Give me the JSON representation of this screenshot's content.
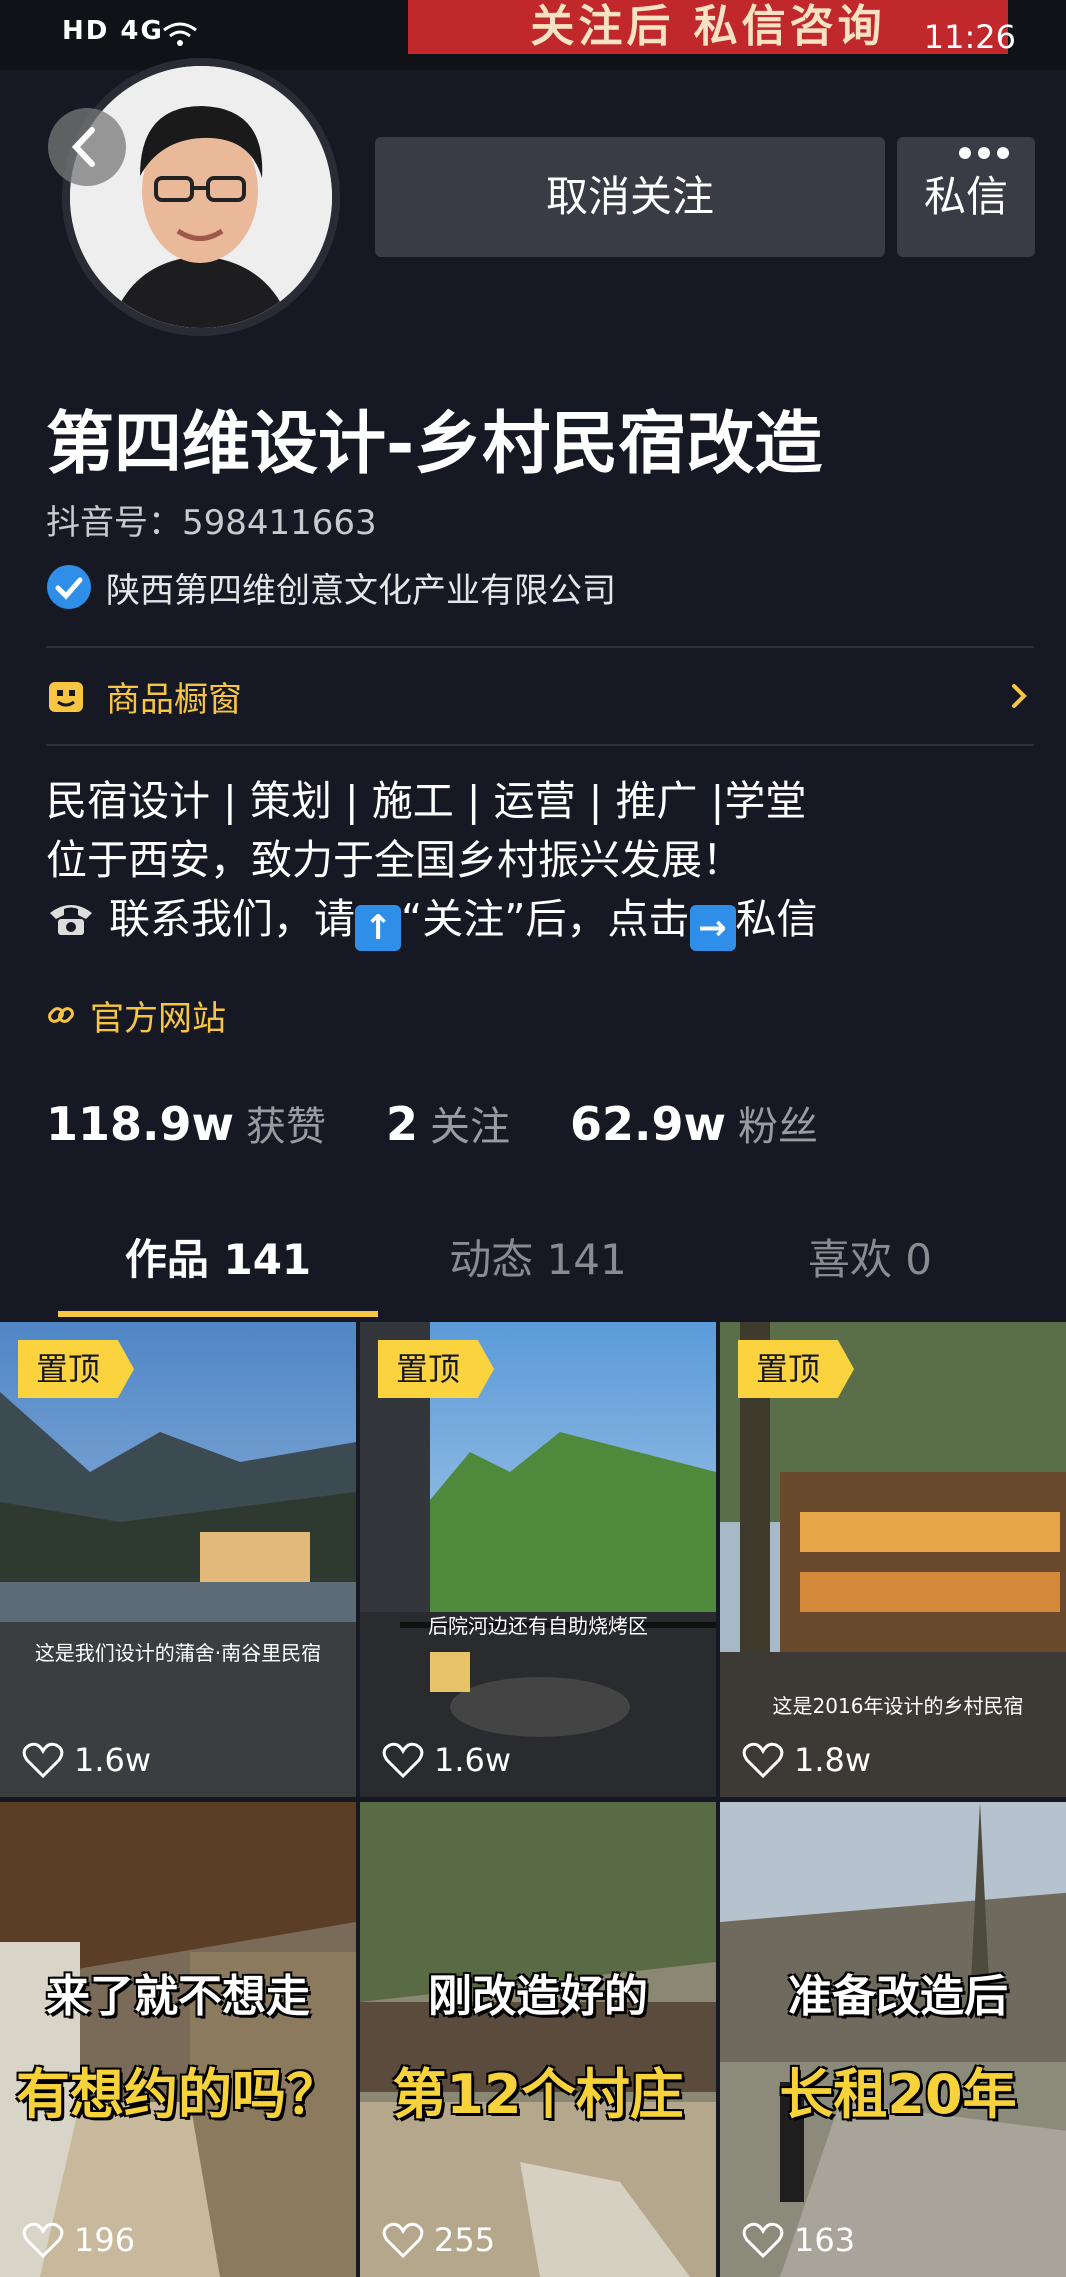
{
  "status_bar": {
    "left": "HD 4G",
    "time": "11:26"
  },
  "banner_text": "关注后 私信咨询",
  "header": {
    "unfollow_label": "取消关注",
    "message_label": "私信",
    "title": "第四维设计-乡村民宿改造",
    "douyin_id": "抖音号：598411663",
    "verification": "陕西第四维创意文化产业有限公司"
  },
  "shop": {
    "label": "商品橱窗"
  },
  "bio": {
    "line1": "民宿设计 | 策划 | 施工 | 运营 | 推广 |学堂",
    "line2": "位于西安，致力于全国乡村振兴发展！",
    "line3a": "联系我们，请",
    "line3b": "“关注”后，点击",
    "line3c": "私信"
  },
  "website": {
    "label": "官方网站"
  },
  "stats": {
    "likes": "118.9w",
    "likes_label": "获赞",
    "following": "2",
    "following_label": "关注",
    "fans": "62.9w",
    "fans_label": "粉丝"
  },
  "tabs": [
    {
      "label": "作品 141"
    },
    {
      "label": "动态 141"
    },
    {
      "label": "喜欢 0"
    }
  ],
  "videos": [
    {
      "pin": "置顶",
      "caption": "这是我们设计的蒲舍·南谷里民宿",
      "likes": "1.6w"
    },
    {
      "pin": "置顶",
      "caption": "后院河边还有自助烧烤区",
      "likes": "1.6w"
    },
    {
      "pin": "置顶",
      "caption": "这是2016年设计的乡村民宿",
      "likes": "1.8w"
    },
    {
      "line1": "来了就不想走",
      "line2": "有想约的吗？",
      "likes": "196"
    },
    {
      "line1": "刚改造好的",
      "line2": "第12个村庄",
      "likes": "255"
    },
    {
      "line1": "准备改造后",
      "line2": "长租20年",
      "likes": "163"
    }
  ],
  "colors": {
    "background": "#161823",
    "accent": "#f8c543",
    "button": "#3a3b44",
    "verify": "#2f8ee8"
  }
}
